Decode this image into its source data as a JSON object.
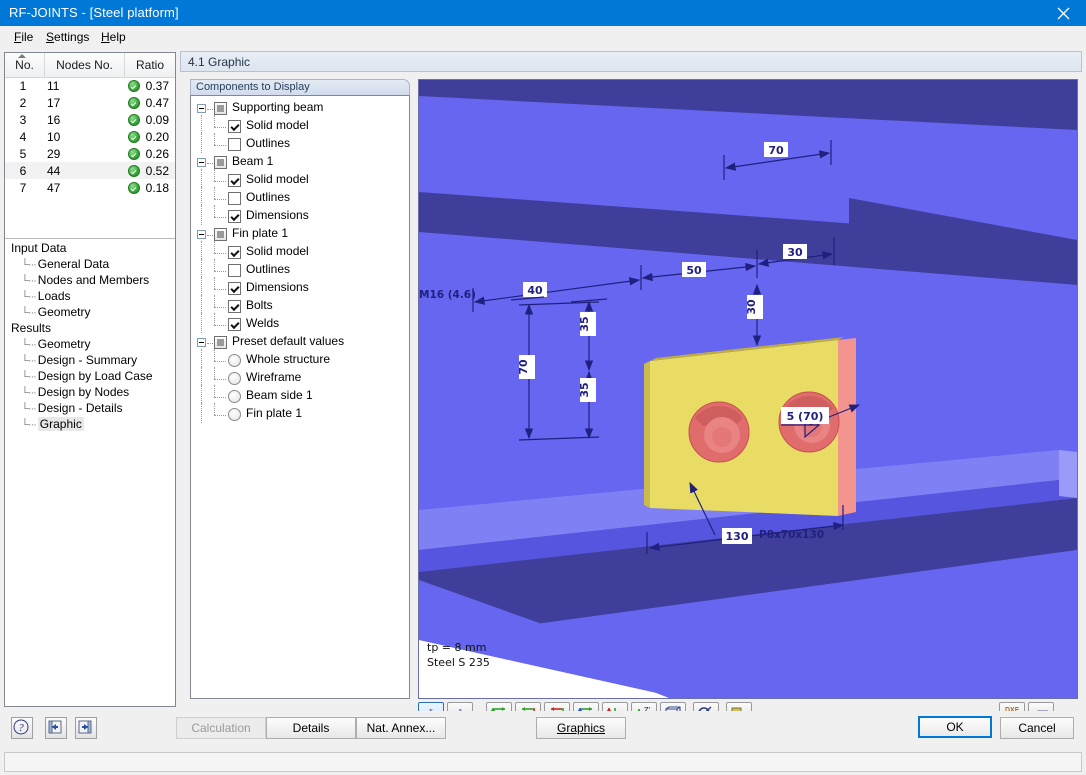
{
  "window": {
    "title": "RF-JOINTS - [Steel platform]",
    "close_label": "close-icon"
  },
  "menu": [
    {
      "label": "File",
      "accel": "F"
    },
    {
      "label": "Settings",
      "accel": "S"
    },
    {
      "label": "Help",
      "accel": "H"
    }
  ],
  "grid": {
    "columns": [
      "No.",
      "Nodes No.",
      "Ratio"
    ],
    "rows": [
      {
        "no": "1",
        "nodes": "11",
        "ratio": "0.37",
        "status": "ok",
        "selected": false
      },
      {
        "no": "2",
        "nodes": "17",
        "ratio": "0.47",
        "status": "ok",
        "selected": false
      },
      {
        "no": "3",
        "nodes": "16",
        "ratio": "0.09",
        "status": "ok",
        "selected": false
      },
      {
        "no": "4",
        "nodes": "10",
        "ratio": "0.20",
        "status": "ok",
        "selected": false
      },
      {
        "no": "5",
        "nodes": "29",
        "ratio": "0.26",
        "status": "ok",
        "selected": false
      },
      {
        "no": "6",
        "nodes": "44",
        "ratio": "0.52",
        "status": "ok",
        "selected": true
      },
      {
        "no": "7",
        "nodes": "47",
        "ratio": "0.18",
        "status": "ok",
        "selected": false
      }
    ]
  },
  "nav": {
    "groups": [
      {
        "title": "Input Data",
        "items": [
          "General Data",
          "Nodes and Members",
          "Loads",
          "Geometry"
        ]
      },
      {
        "title": "Results",
        "items": [
          "Geometry",
          "Design - Summary",
          "Design by Load Case",
          "Design by Nodes",
          "Design - Details",
          "Graphic"
        ]
      }
    ],
    "active_item": "Graphic"
  },
  "section": {
    "title": "4.1 Graphic"
  },
  "tree": {
    "caption": "Components to Display",
    "nodes": [
      {
        "label": "Supporting beam",
        "type": "group",
        "depth": 0
      },
      {
        "label": "Solid model",
        "type": "checkbox",
        "checked": true,
        "depth": 1
      },
      {
        "label": "Outlines",
        "type": "checkbox",
        "checked": false,
        "depth": 1
      },
      {
        "label": "Beam 1",
        "type": "group",
        "depth": 0
      },
      {
        "label": "Solid model",
        "type": "checkbox",
        "checked": true,
        "depth": 1
      },
      {
        "label": "Outlines",
        "type": "checkbox",
        "checked": false,
        "depth": 1
      },
      {
        "label": "Dimensions",
        "type": "checkbox",
        "checked": true,
        "depth": 1
      },
      {
        "label": "Fin plate 1",
        "type": "group",
        "depth": 0
      },
      {
        "label": "Solid model",
        "type": "checkbox",
        "checked": true,
        "depth": 1
      },
      {
        "label": "Outlines",
        "type": "checkbox",
        "checked": false,
        "depth": 1
      },
      {
        "label": "Dimensions",
        "type": "checkbox",
        "checked": true,
        "depth": 1
      },
      {
        "label": "Bolts",
        "type": "checkbox",
        "checked": true,
        "depth": 1
      },
      {
        "label": "Welds",
        "type": "checkbox",
        "checked": true,
        "depth": 1
      },
      {
        "label": "Preset default values",
        "type": "group",
        "depth": 0
      },
      {
        "label": "Whole structure",
        "type": "radio",
        "checked": false,
        "depth": 1
      },
      {
        "label": "Wireframe",
        "type": "radio",
        "checked": false,
        "depth": 1
      },
      {
        "label": "Beam side 1",
        "type": "radio",
        "checked": false,
        "depth": 1
      },
      {
        "label": "Fin plate 1",
        "type": "radio",
        "checked": false,
        "depth": 1
      }
    ]
  },
  "graphic": {
    "note_line1": "tp = 8 mm",
    "note_line2": "Steel S 235",
    "annotations": [
      {
        "text": "70",
        "kind": "dimension"
      },
      {
        "text": "30",
        "kind": "dimension"
      },
      {
        "text": "50",
        "kind": "dimension"
      },
      {
        "text": "40",
        "kind": "dimension"
      },
      {
        "text": "30",
        "kind": "dimension"
      },
      {
        "text": "M16 (4.6)",
        "kind": "label"
      },
      {
        "text": "35",
        "kind": "dimension"
      },
      {
        "text": "70",
        "kind": "dimension"
      },
      {
        "text": "35",
        "kind": "dimension"
      },
      {
        "text": "5 (70)",
        "kind": "weld-label"
      },
      {
        "text": "130",
        "kind": "dimension"
      },
      {
        "text": "P8x70x130",
        "kind": "label"
      }
    ],
    "colors": {
      "beam_light": "#6666f0",
      "beam_dark": "#3f3f9b",
      "plate": "#e8dc64",
      "plate_edge": "#f4948f",
      "bolt": "#e06c6c",
      "dimension_line": "#202080",
      "background": "#ffffff"
    },
    "toolbar": [
      {
        "name": "view-x",
        "label": "x",
        "active": true
      },
      {
        "name": "view-a",
        "label": "a",
        "active": false
      },
      {
        "name": "view-xprime",
        "label": "X'",
        "active": false
      },
      {
        "name": "view-neg-xprime",
        "label": "-X'",
        "active": false
      },
      {
        "name": "view-yprime",
        "label": "Y'",
        "active": false
      },
      {
        "name": "view-neg-yprime",
        "label": "-Y'",
        "active": false
      },
      {
        "name": "view-zprime",
        "label": "Z'",
        "active": false
      },
      {
        "name": "view-axes-zprime",
        "label": "Z'",
        "active": false
      },
      {
        "name": "view-isometric",
        "label": "",
        "active": false
      },
      {
        "name": "zoom-tool",
        "label": "",
        "active": false
      },
      {
        "name": "layers-tool",
        "label": "",
        "active": false
      }
    ],
    "toolbar_right": [
      {
        "name": "dxf-export",
        "label": "DXF"
      },
      {
        "name": "print",
        "label": ""
      }
    ]
  },
  "bottom": {
    "icon_buttons": [
      {
        "name": "help-button",
        "label": "?"
      },
      {
        "name": "prev-button",
        "label": ""
      },
      {
        "name": "next-button",
        "label": ""
      }
    ],
    "buttons": [
      {
        "name": "calculation-button",
        "label": "Calculation",
        "disabled": true
      },
      {
        "name": "details-button",
        "label": "Details",
        "disabled": false
      },
      {
        "name": "nat-annex-button",
        "label": "Nat. Annex...",
        "disabled": false
      },
      {
        "name": "graphics-button",
        "label": "Graphics",
        "disabled": false,
        "accel": "G"
      }
    ],
    "ok_label": "OK",
    "cancel_label": "Cancel"
  }
}
